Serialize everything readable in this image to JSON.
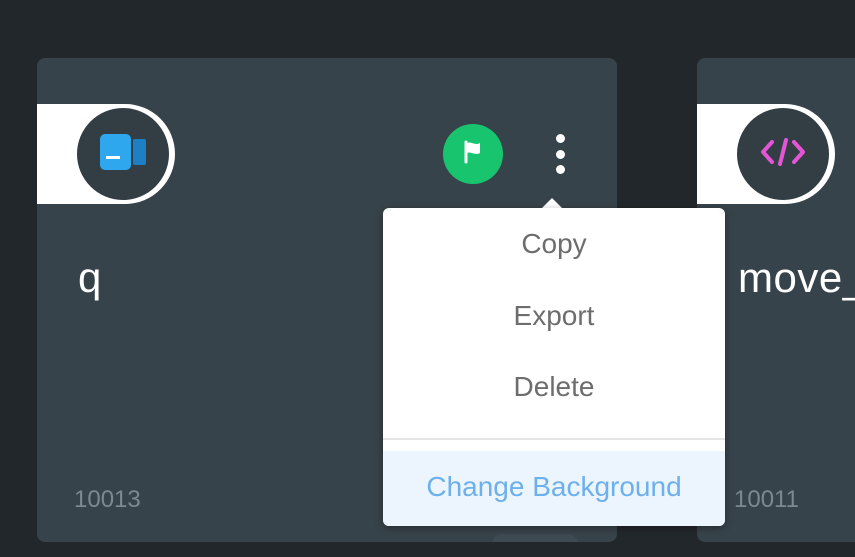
{
  "cards": [
    {
      "title": "q",
      "id": "10013",
      "icon": "video-camera-icon",
      "icon_color": "#2fa7ee"
    },
    {
      "title": "move_",
      "id": "10011",
      "icon": "code-icon",
      "icon_color": "#e455d6"
    }
  ],
  "actions": {
    "flag_color": "#18c46e",
    "flag_icon": "flag-icon",
    "more_icon": "more-vertical-icon"
  },
  "menu": {
    "items": [
      {
        "label": "Copy"
      },
      {
        "label": "Export"
      },
      {
        "label": "Delete"
      }
    ],
    "highlight_item": {
      "label": "Change Background"
    },
    "highlight_color": "#6cb0ec"
  }
}
